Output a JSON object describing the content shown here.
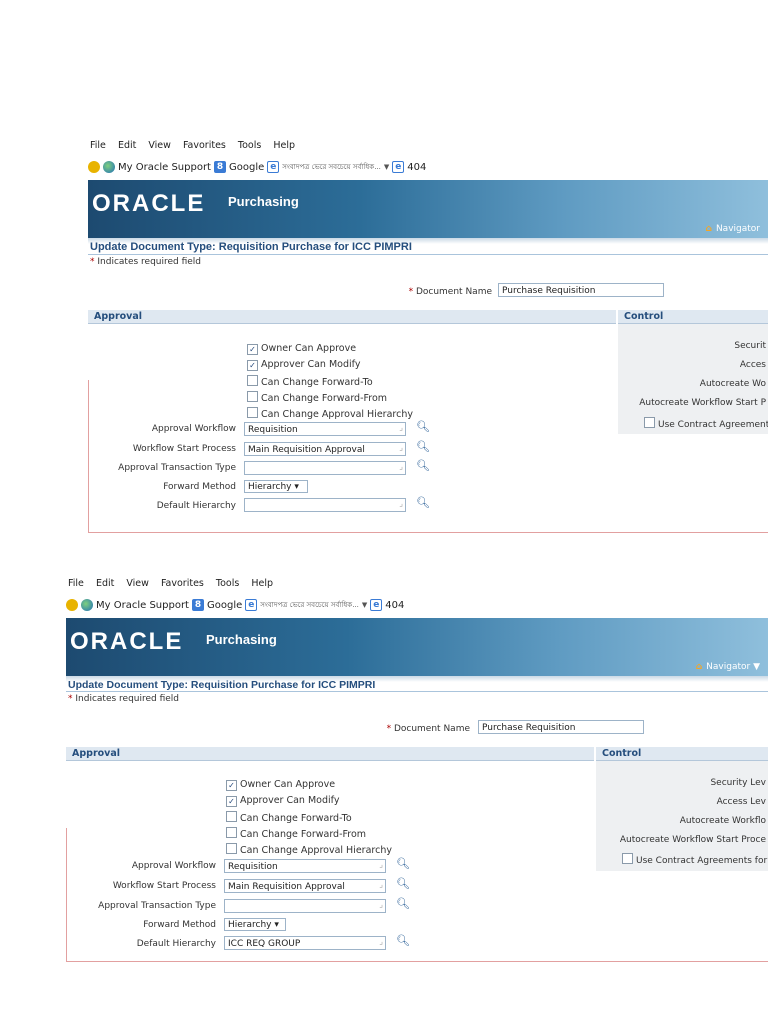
{
  "menu": [
    "File",
    "Edit",
    "View",
    "Favorites",
    "Tools",
    "Help"
  ],
  "favorites": {
    "oracle_support": "My Oracle Support",
    "google": "Google",
    "bengali_link": "সংবাদপত্র ভেরে সবচেয়ে সর্বাধিক...",
    "error_link": "404"
  },
  "app": {
    "logo": "ORACLE",
    "name": "Purchasing",
    "navigator": "Navigator"
  },
  "page": {
    "title": "Update Document Type: Requisition Purchase for ICC PIMPRI",
    "required_note": "Indicates required field",
    "document_name_label": "Document Name",
    "document_name_value": "Purchase Requisition"
  },
  "approval": {
    "header": "Approval",
    "checkboxes": [
      {
        "label": "Owner Can Approve",
        "checked": true
      },
      {
        "label": "Approver Can Modify",
        "checked": true
      },
      {
        "label": "Can Change Forward-To",
        "checked": false
      },
      {
        "label": "Can Change Forward-From",
        "checked": false
      },
      {
        "label": "Can Change Approval Hierarchy",
        "checked": false
      }
    ],
    "approval_workflow_label": "Approval Workflow",
    "approval_workflow_value": "Requisition",
    "workflow_start_label": "Workflow Start Process",
    "workflow_start_value": "Main Requisition Approval",
    "transaction_type_label": "Approval Transaction Type",
    "transaction_type_value": "",
    "forward_method_label": "Forward Method",
    "forward_method_value": "Hierarchy",
    "default_hierarchy_label": "Default Hierarchy"
  },
  "control": {
    "header": "Control",
    "shot1": {
      "security": "Securit",
      "access": "Acces",
      "autocreate": "Autocreate Wo",
      "autocreate_start": "Autocreate Workflow Start P",
      "contract": "Use Contract Agreement"
    },
    "shot2": {
      "security": "Security Lev",
      "access": "Access Lev",
      "autocreate": "Autocreate Workflo",
      "autocreate_start": "Autocreate Workflow Start Proce",
      "contract": "Use Contract Agreements for"
    }
  },
  "shot1": {
    "default_hierarchy_value": ""
  },
  "shot2": {
    "default_hierarchy_value": "ICC REQ GROUP"
  }
}
